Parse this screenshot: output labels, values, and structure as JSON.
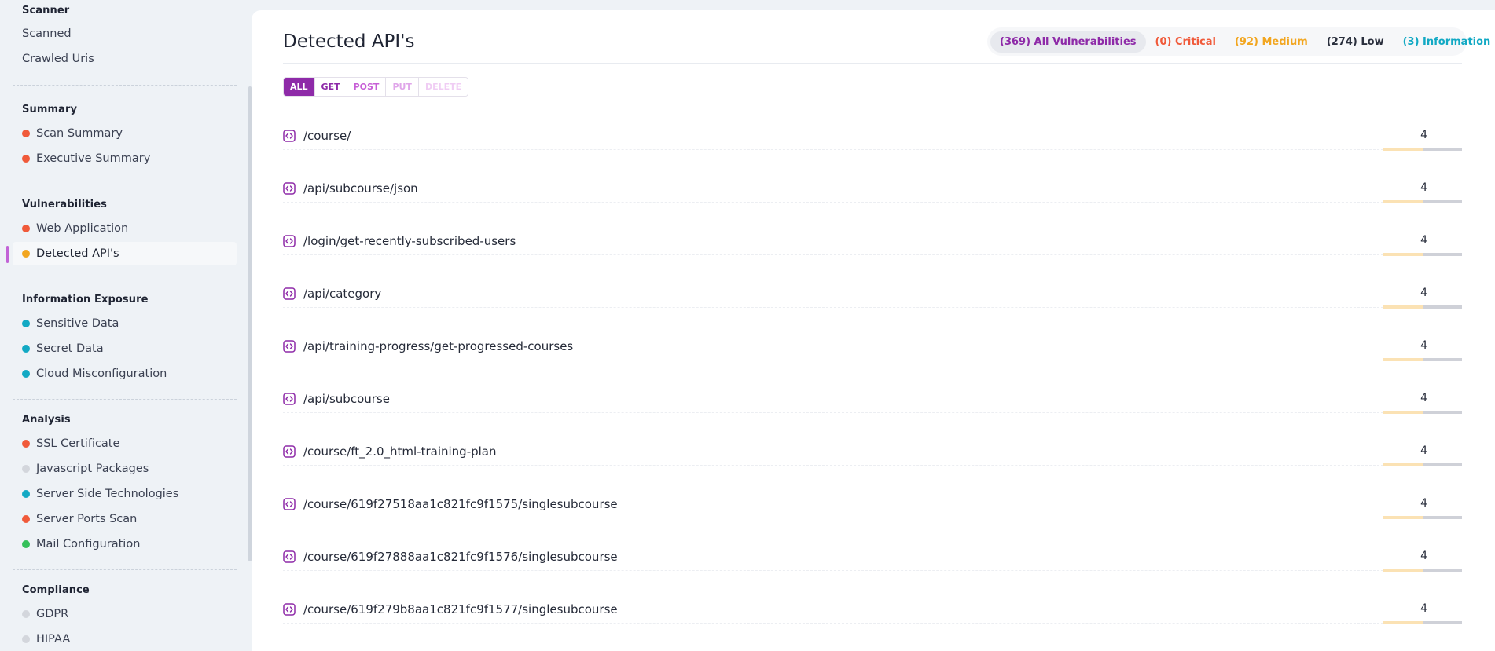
{
  "colors": {
    "critical": "#f05a3a",
    "medium": "#f2a620",
    "low": "#2a2f3d",
    "info": "#12a9c4",
    "primary": "#8e2aa8",
    "none": "#d3d6dc",
    "green": "#35c05a"
  },
  "sidebar": {
    "sections": [
      {
        "title": "Scanner",
        "items": [
          {
            "label": "Scanned",
            "dot": null
          },
          {
            "label": "Crawled Uris",
            "dot": null
          }
        ]
      },
      {
        "title": "Summary",
        "items": [
          {
            "label": "Scan Summary",
            "dot": "#f05a3a"
          },
          {
            "label": "Executive Summary",
            "dot": "#f05a3a"
          }
        ]
      },
      {
        "title": "Vulnerabilities",
        "items": [
          {
            "label": "Web Application",
            "dot": "#f05a3a"
          },
          {
            "label": "Detected API's",
            "dot": "#f2a620",
            "active": true
          }
        ]
      },
      {
        "title": "Information Exposure",
        "items": [
          {
            "label": "Sensitive Data",
            "dot": "#12a9c4"
          },
          {
            "label": "Secret Data",
            "dot": "#12a9c4"
          },
          {
            "label": "Cloud Misconfiguration",
            "dot": "#12a9c4"
          }
        ]
      },
      {
        "title": "Analysis",
        "items": [
          {
            "label": "SSL Certificate",
            "dot": "#f05a3a"
          },
          {
            "label": "Javascript Packages",
            "dot": "#d3d6dc"
          },
          {
            "label": "Server Side Technologies",
            "dot": "#12a9c4"
          },
          {
            "label": "Server Ports Scan",
            "dot": "#f05a3a"
          },
          {
            "label": "Mail Configuration",
            "dot": "#35c05a"
          }
        ]
      },
      {
        "title": "Compliance",
        "items": [
          {
            "label": "GDPR",
            "dot": "#d3d6dc"
          },
          {
            "label": "HIPAA",
            "dot": "#d3d6dc"
          }
        ]
      }
    ]
  },
  "main": {
    "title": "Detected API's",
    "filters": [
      {
        "label": "(369) All Vulnerabilities",
        "color": "#8e2aa8",
        "selected": true
      },
      {
        "label": "(0) Critical",
        "color": "#f05a3a"
      },
      {
        "label": "(92) Medium",
        "color": "#f2a620"
      },
      {
        "label": "(274) Low",
        "color": "#2a2f3d"
      },
      {
        "label": "(3) Information",
        "color": "#12a9c4"
      }
    ],
    "methods": [
      {
        "label": "ALL",
        "active": true,
        "color": "#ffffff"
      },
      {
        "label": "GET",
        "color": "#8e2aa8"
      },
      {
        "label": "POST",
        "color": "#c75fd6"
      },
      {
        "label": "PUT",
        "color": "#e0a6ea"
      },
      {
        "label": "DELETE",
        "color": "#f0cdf4"
      }
    ],
    "apis": [
      {
        "path": "/course/",
        "count": "4",
        "medium_fraction": 0.5
      },
      {
        "path": "/api/subcourse/json",
        "count": "4",
        "medium_fraction": 0.5
      },
      {
        "path": "/login/get-recently-subscribed-users",
        "count": "4",
        "medium_fraction": 0.5
      },
      {
        "path": "/api/category",
        "count": "4",
        "medium_fraction": 0.5
      },
      {
        "path": "/api/training-progress/get-progressed-courses",
        "count": "4",
        "medium_fraction": 0.5
      },
      {
        "path": "/api/subcourse",
        "count": "4",
        "medium_fraction": 0.5
      },
      {
        "path": "/course/ft_2.0_html-training-plan",
        "count": "4",
        "medium_fraction": 0.5
      },
      {
        "path": "/course/619f27518aa1c821fc9f1575/singlesubcourse",
        "count": "4",
        "medium_fraction": 0.5
      },
      {
        "path": "/course/619f27888aa1c821fc9f1576/singlesubcourse",
        "count": "4",
        "medium_fraction": 0.5
      },
      {
        "path": "/course/619f279b8aa1c821fc9f1577/singlesubcourse",
        "count": "4",
        "medium_fraction": 0.5
      }
    ]
  }
}
